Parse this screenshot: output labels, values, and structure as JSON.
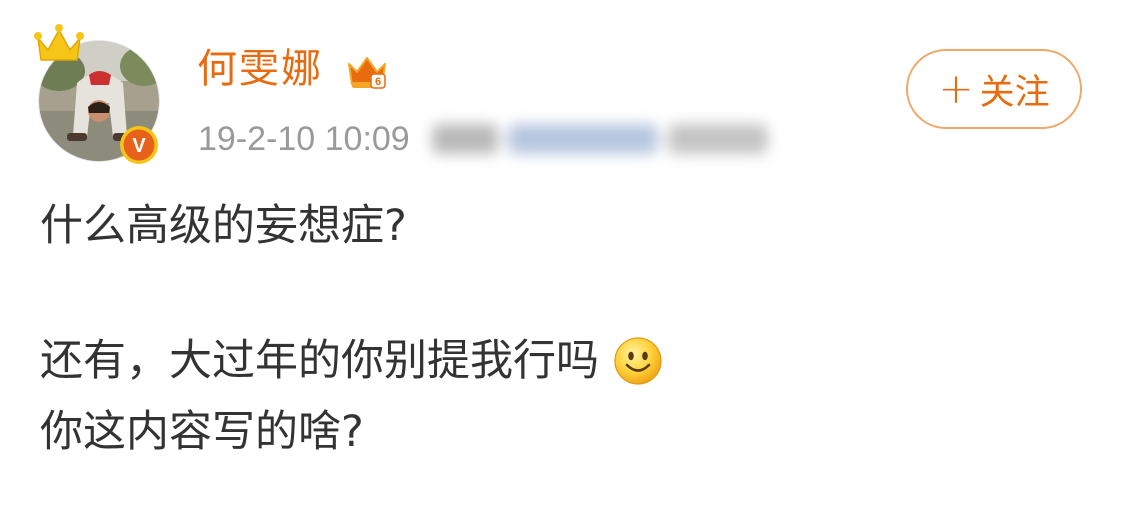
{
  "post": {
    "author": "何雯娜",
    "timestamp": "19-2-10 10:09",
    "follow_label": "关注",
    "follow_plus": "+",
    "lines": [
      "什么高级的妄想症?",
      "还有，大过年的你别提我行吗",
      "你这内容写的啥?"
    ],
    "badge_letter": "V",
    "vip_level": "6"
  },
  "icons": {
    "crown": "crown-icon",
    "verified": "verified-v-icon",
    "vip": "vip-crown-icon",
    "emoji": "smile-emoji-icon"
  },
  "colors": {
    "accent": "#e86b10",
    "follow_border": "#f0a86a",
    "verified": "#e8611a",
    "gold": "#f5c518",
    "meta_text": "#9a9a9a",
    "body_text": "#333333"
  }
}
